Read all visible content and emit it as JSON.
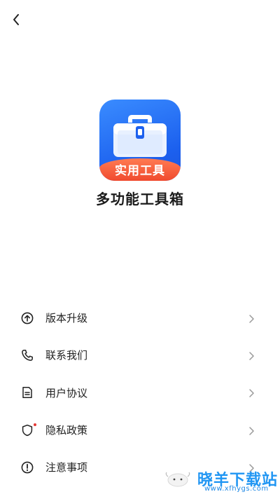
{
  "header": {
    "back_icon": "chevron-left-icon"
  },
  "app": {
    "name": "多功能工具箱",
    "icon_banner_text": "实用工具",
    "icon_colors": {
      "background": "#1f66f0",
      "banner": "#f2552f"
    }
  },
  "menu": {
    "items": [
      {
        "label": "版本升级",
        "icon": "arrow-up-circle-icon"
      },
      {
        "label": "联系我们",
        "icon": "phone-icon"
      },
      {
        "label": "用户协议",
        "icon": "document-icon"
      },
      {
        "label": "隐私政策",
        "icon": "shield-icon",
        "badge_dot": true
      },
      {
        "label": "注意事项",
        "icon": "alert-circle-icon"
      }
    ],
    "chevron_icon": "chevron-right-icon"
  },
  "watermark": {
    "text": "晓羊下载站",
    "url": "www.xfhygs.com"
  }
}
